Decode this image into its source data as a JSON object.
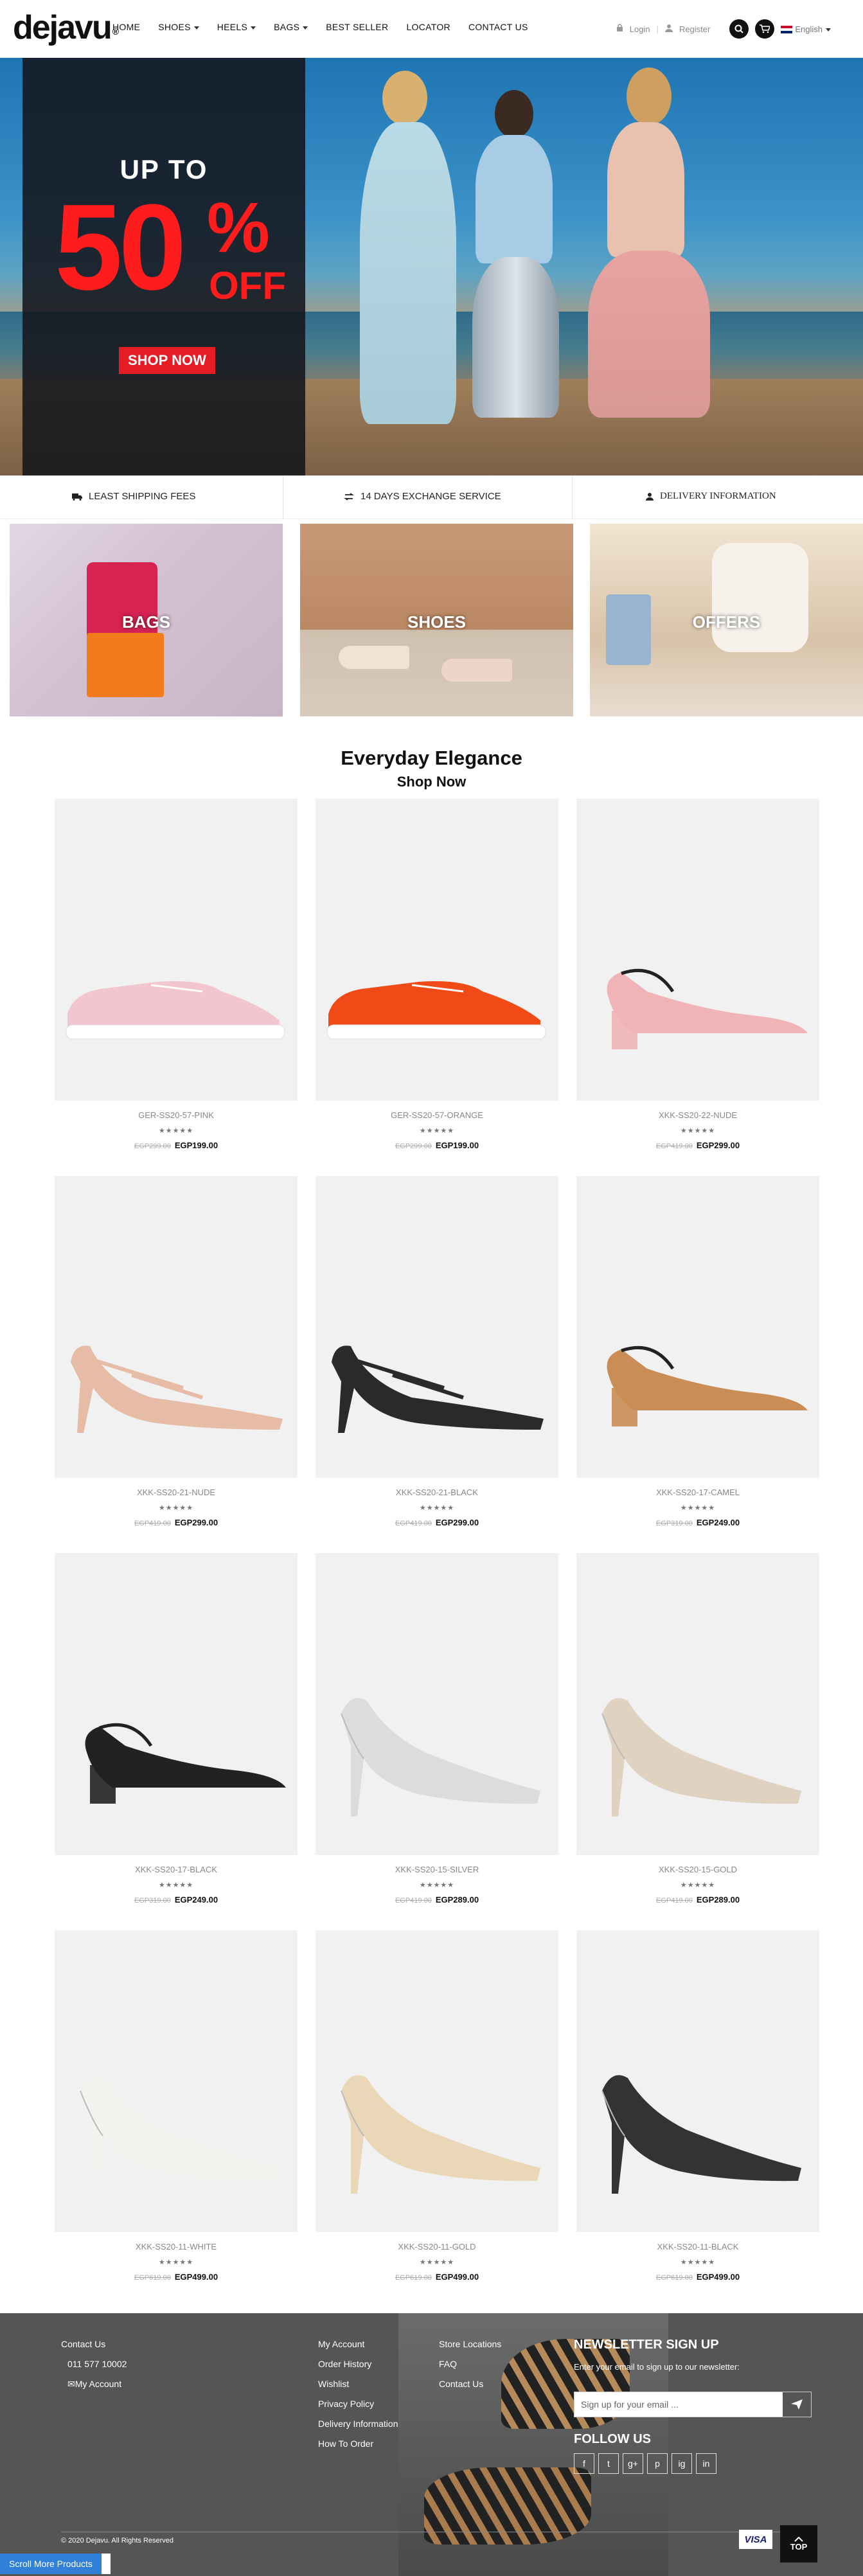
{
  "header": {
    "logo": "dejavu",
    "logo_mark": "®",
    "nav": [
      "HOME",
      "SHOES",
      "HEELS",
      "BAGS",
      "BEST SELLER",
      "LOCATOR",
      "CONTACT US"
    ],
    "login": "Login",
    "register": "Register",
    "language": "English"
  },
  "hero": {
    "up_to": "UP TO",
    "percent": "50",
    "percent_sign": "%",
    "off": "OFF",
    "cta": "SHOP NOW"
  },
  "features": [
    "LEAST SHIPPING FEES",
    "14 DAYS EXCHANGE SERVICE",
    "DELIVERY INFORMATION"
  ],
  "categories": [
    "BAGS",
    "SHOES",
    "OFFERS"
  ],
  "section": {
    "title": "Everyday Elegance",
    "subtitle": "Shop Now"
  },
  "stars": "★★★★★",
  "products": [
    {
      "name": "GER-SS20-57-PINK",
      "old": "EGP299.00",
      "price": "EGP199.00",
      "color": "#f2c6cf",
      "type": "sneaker"
    },
    {
      "name": "GER-SS20-57-ORANGE",
      "old": "EGP299.00",
      "price": "EGP199.00",
      "color": "#f04a16",
      "type": "sneaker"
    },
    {
      "name": "XKK-SS20-22-NUDE",
      "old": "EGP419.00",
      "price": "EGP299.00",
      "color": "#f0b3b6",
      "type": "slingblock"
    },
    {
      "name": "XKK-SS20-21-NUDE",
      "old": "EGP419.00",
      "price": "EGP299.00",
      "color": "#e6bca7",
      "type": "cross"
    },
    {
      "name": "XKK-SS20-21-BLACK",
      "old": "EGP419.00",
      "price": "EGP299.00",
      "color": "#2a2a2a",
      "type": "cross"
    },
    {
      "name": "XKK-SS20-17-CAMEL",
      "old": "EGP319.00",
      "price": "EGP249.00",
      "color": "#c98d55",
      "type": "slingblock"
    },
    {
      "name": "XKK-SS20-17-BLACK",
      "old": "EGP319.00",
      "price": "EGP249.00",
      "color": "#222222",
      "type": "slingblock"
    },
    {
      "name": "XKK-SS20-15-SILVER",
      "old": "EGP419.00",
      "price": "EGP289.00",
      "color": "#dcdcdc",
      "type": "pump"
    },
    {
      "name": "XKK-SS20-15-GOLD",
      "old": "EGP419.00",
      "price": "EGP289.00",
      "color": "#e0d2c0",
      "type": "pump"
    },
    {
      "name": "XKK-SS20-11-WHITE",
      "old": "EGP619.00",
      "price": "EGP499.00",
      "color": "#f4f2ee",
      "type": "pump"
    },
    {
      "name": "XKK-SS20-11-GOLD",
      "old": "EGP619.00",
      "price": "EGP499.00",
      "color": "#ead7b8",
      "type": "pump"
    },
    {
      "name": "XKK-SS20-11-BLACK",
      "old": "EGP619.00",
      "price": "EGP499.00",
      "color": "#333333",
      "type": "pump"
    }
  ],
  "footer": {
    "col1": [
      "Contact Us",
      "011 577 10002",
      "My Account"
    ],
    "col2": [
      "My Account",
      "Order History",
      "Wishlist",
      "Privacy Policy",
      "Delivery Information",
      "How To Order"
    ],
    "col3": [
      "Store Locations",
      "FAQ",
      "Contact Us"
    ],
    "newsletter_title": "NEWSLETTER SIGN UP",
    "newsletter_text": "Enter your email to sign up to our newsletter:",
    "newsletter_placeholder": "Sign up for your email ...",
    "follow": "FOLLOW US",
    "social": [
      "f",
      "t",
      "g+",
      "p",
      "ig",
      "in"
    ],
    "copyright": "© 2020 Dejavu. All Rights Reserved",
    "visa": "VISA",
    "top": "TOP",
    "scroll_more": "Scroll More Products"
  }
}
